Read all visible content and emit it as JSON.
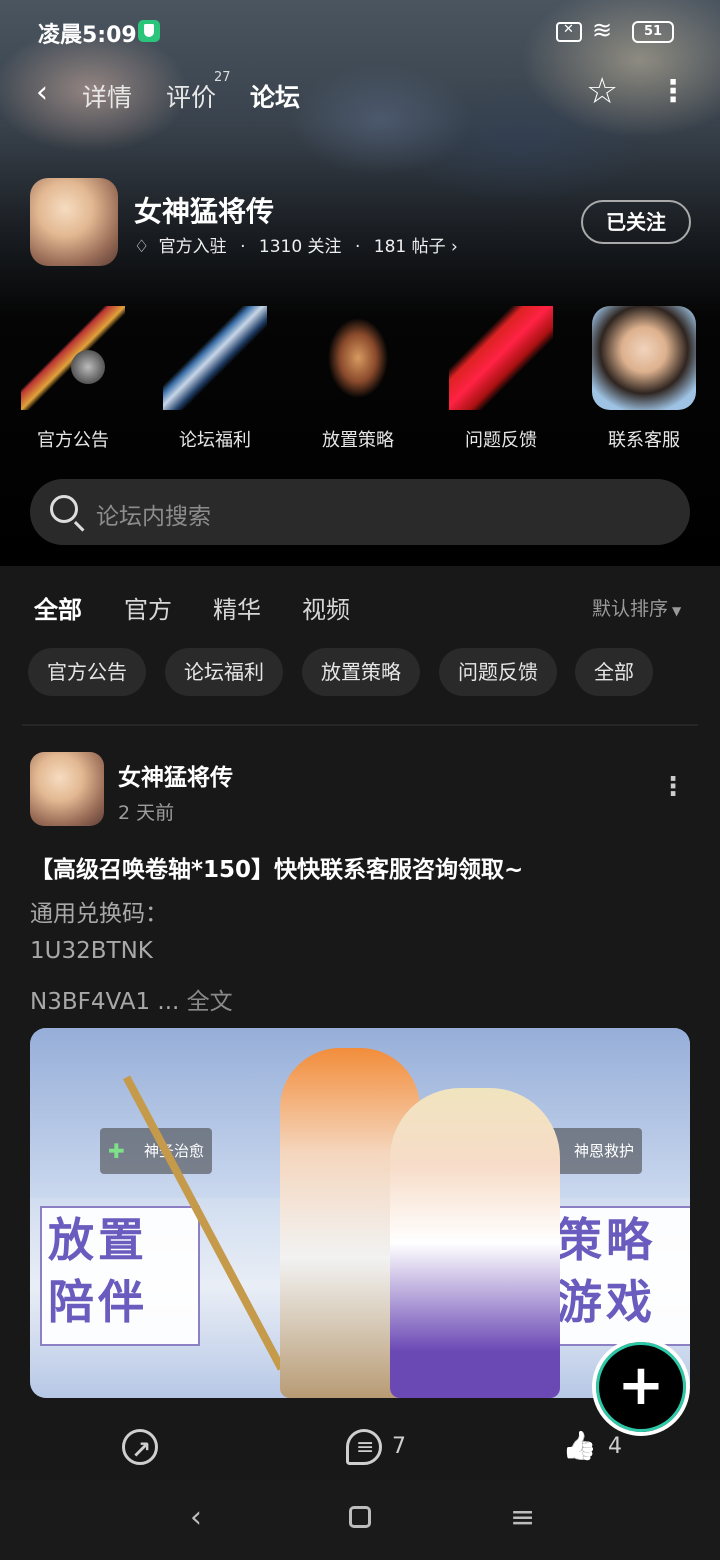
{
  "status_bar": {
    "time": "凌晨5:09",
    "battery": "51"
  },
  "nav": {
    "back_icon": "chevron-left-icon",
    "tabs": [
      {
        "label": "详情"
      },
      {
        "label": "评价",
        "badge": "27"
      },
      {
        "label": "论坛",
        "active": true
      }
    ],
    "accent": "#17c7a6"
  },
  "game": {
    "title": "女神猛将传",
    "official": "官方入驻",
    "dot": "·",
    "followers": "1310 关注",
    "posts": "181 帖子",
    "chevron": "›",
    "follow_label": "已关注"
  },
  "quick_links": [
    {
      "label": "官方公告",
      "icon": "mace-icon"
    },
    {
      "label": "论坛福利",
      "icon": "axe-icon"
    },
    {
      "label": "放置策略",
      "icon": "armor-icon"
    },
    {
      "label": "问题反馈",
      "icon": "gauntlet-icon"
    },
    {
      "label": "联系客服",
      "icon": "support-avatar-icon"
    }
  ],
  "search": {
    "placeholder": "论坛内搜索"
  },
  "filter_tabs": [
    "全部",
    "官方",
    "精华",
    "视频"
  ],
  "sort_label": "默认排序",
  "chips": [
    "官方公告",
    "论坛福利",
    "放置策略",
    "问题反馈",
    "全部"
  ],
  "post": {
    "author": "女神猛将传",
    "time": "2 天前",
    "title": "【高级召唤卷轴*150】快快联系客服咨询领取~",
    "lines": [
      "通用兑换码：",
      "1U32BTNK",
      "N3BF4VA1 ..."
    ],
    "full_text_link": "全文",
    "image": {
      "left_text": [
        "放置",
        "陪伴"
      ],
      "right_text": [
        "策略",
        "游戏"
      ],
      "tag_left": "神圣治愈",
      "tag_right": "神恩救护"
    },
    "comments": "7",
    "likes": "4"
  }
}
